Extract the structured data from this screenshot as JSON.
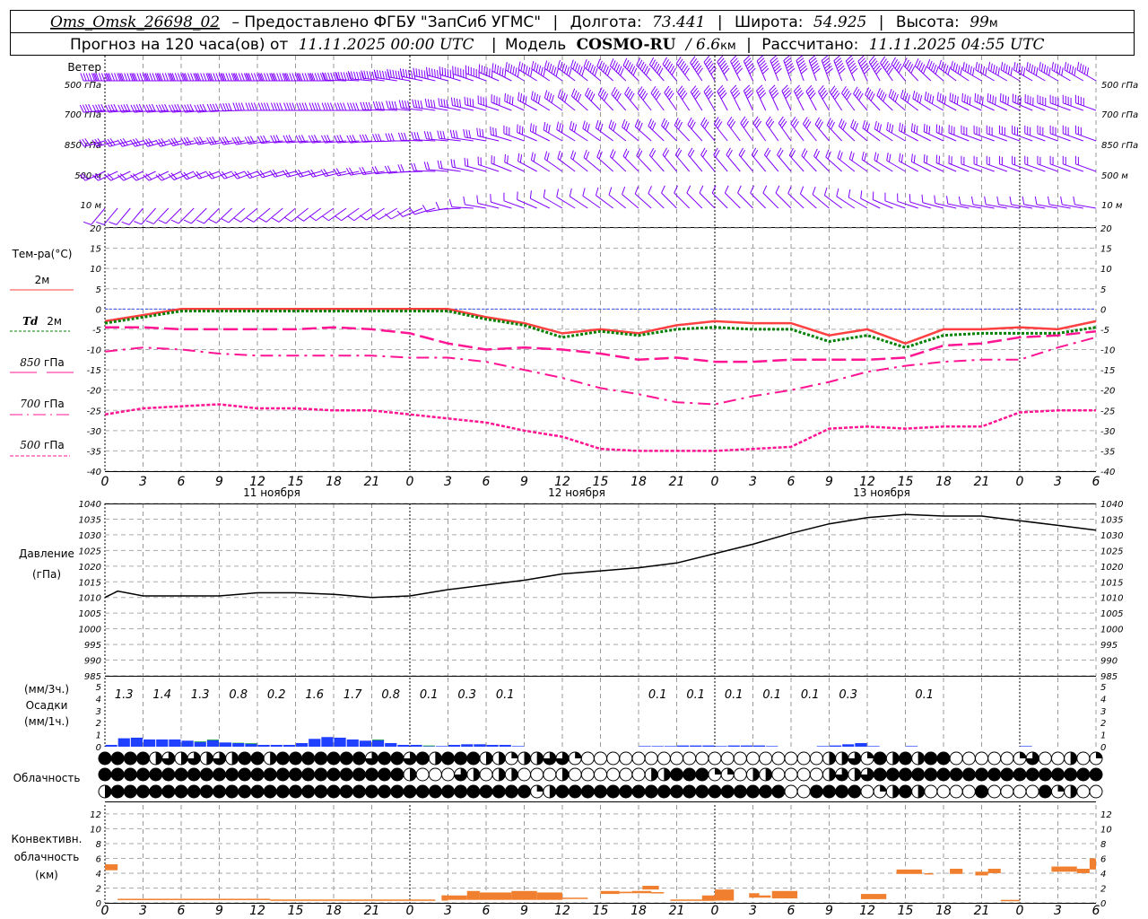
{
  "header": {
    "station": "Oms_Omsk_26698_02",
    "provider": "– Предоставлено ФГБУ \"ЗапСиб УГМС\"",
    "lon_label": "Долгота:",
    "lon": "73.441",
    "lat_label": "Широта:",
    "lat": "54.925",
    "alt_label": "Высота:",
    "alt": "99",
    "alt_unit": "м",
    "forecast_label": "Прогноз на 120 часа(ов) от",
    "forecast_time": "11.11.2025 00:00 UTC",
    "model_label": "Модель",
    "model": "COSMO-RU",
    "res": "/ 6.6",
    "res_unit": "км",
    "calc_label": "Рассчитано:",
    "calc_time": "11.11.2025 04:55 UTC"
  },
  "labels": {
    "wind": "Ветер",
    "wind_levels": [
      "500 гПа",
      "700 гПа",
      "850 гПа",
      "500 м",
      "10  м"
    ],
    "temp": "Тем-ра(°C)",
    "legend_2m": "2м",
    "legend_td": "Td",
    "legend_td2": "2м",
    "legend_850": "850",
    "legend_700": "700",
    "legend_500": "500",
    "legend_unit": "гПа",
    "pressure": "Давление",
    "pressure_unit": "(гПа)",
    "precip_3h": "(мм/3ч.)",
    "precip": "Осадки",
    "precip_1h": "(мм/1ч.)",
    "cloud": "Облачность",
    "conv1": "Конвективн.",
    "conv2": "облачность",
    "conv3": "(км)",
    "dates": [
      "11 ноября",
      "12 ноября",
      "13 ноября"
    ]
  },
  "colors": {
    "t2m": "#ff4040",
    "td": "#008000",
    "upper": "#ff1493",
    "zero": "#3050ff",
    "precip": "#2040ff",
    "snow": "#20c020",
    "conv": "#f08030",
    "wind": "#8000ff"
  },
  "chart_data": [
    {
      "type": "wind-barbs",
      "title": "Ветер",
      "hours_step": 3,
      "levels": [
        {
          "name": "500 гПа",
          "dir": [
            270,
            270,
            270,
            270,
            270,
            270,
            270,
            275,
            280,
            285,
            290,
            300,
            305,
            310,
            315,
            320,
            330,
            335,
            340,
            340,
            335,
            320,
            310,
            300,
            300,
            300,
            300
          ],
          "speed": [
            28,
            28,
            28,
            28,
            28,
            28,
            28,
            28,
            28,
            28,
            28,
            28,
            28,
            28,
            28,
            28,
            28,
            28,
            28,
            28,
            28,
            25,
            25,
            25,
            25,
            25,
            25
          ]
        },
        {
          "name": "700 гПа",
          "dir": [
            265,
            265,
            265,
            265,
            270,
            270,
            270,
            270,
            275,
            280,
            285,
            295,
            305,
            315,
            320,
            325,
            330,
            335,
            335,
            330,
            320,
            310,
            300,
            295,
            295,
            290,
            290
          ],
          "speed": [
            22,
            22,
            22,
            22,
            22,
            22,
            22,
            22,
            22,
            22,
            22,
            22,
            22,
            22,
            22,
            22,
            22,
            22,
            22,
            22,
            20,
            20,
            20,
            20,
            20,
            20,
            20
          ]
        },
        {
          "name": "850 гПа",
          "dir": [
            255,
            255,
            255,
            260,
            260,
            265,
            265,
            265,
            270,
            275,
            280,
            290,
            300,
            305,
            310,
            315,
            320,
            325,
            325,
            320,
            310,
            300,
            295,
            290,
            290,
            290,
            290
          ],
          "speed": [
            17,
            17,
            17,
            17,
            17,
            17,
            17,
            17,
            17,
            17,
            17,
            15,
            15,
            15,
            15,
            15,
            15,
            15,
            15,
            15,
            15,
            15,
            15,
            15,
            15,
            15,
            15
          ]
        },
        {
          "name": "500 м",
          "dir": [
            245,
            245,
            245,
            250,
            250,
            255,
            255,
            260,
            265,
            275,
            285,
            295,
            305,
            310,
            315,
            320,
            320,
            320,
            320,
            315,
            305,
            300,
            295,
            290,
            290,
            290,
            290
          ],
          "speed": [
            12,
            12,
            12,
            12,
            12,
            12,
            12,
            12,
            12,
            10,
            10,
            10,
            10,
            10,
            10,
            10,
            10,
            10,
            10,
            10,
            10,
            12,
            12,
            12,
            12,
            12,
            12
          ]
        },
        {
          "name": "10  м",
          "dir": [
            220,
            220,
            225,
            225,
            230,
            230,
            235,
            235,
            240,
            260,
            280,
            290,
            300,
            305,
            310,
            315,
            315,
            315,
            315,
            310,
            300,
            290,
            285,
            280,
            280,
            280,
            280
          ],
          "speed": [
            5,
            5,
            5,
            5,
            5,
            5,
            5,
            5,
            5,
            5,
            5,
            5,
            5,
            5,
            5,
            5,
            5,
            5,
            5,
            5,
            5,
            5,
            5,
            5,
            5,
            5,
            5
          ]
        }
      ]
    },
    {
      "type": "line",
      "title": "Тем-ра(°C)",
      "x_hours": [
        0,
        3,
        6,
        9,
        12,
        15,
        18,
        21,
        24,
        27,
        30,
        33,
        36,
        39,
        42,
        45,
        48,
        51,
        54,
        57,
        60,
        63,
        66,
        69,
        72,
        75,
        78
      ],
      "ylim": [
        -40,
        20
      ],
      "yticks": [
        20,
        15,
        10,
        5,
        0,
        -5,
        -10,
        -15,
        -20,
        -25,
        -30,
        -35,
        -40
      ],
      "grid": true,
      "series": [
        {
          "name": "2м",
          "style": "solid",
          "values": [
            -3,
            -1.5,
            0,
            0,
            0,
            0,
            0,
            0,
            0,
            0,
            -2,
            -3.5,
            -6,
            -5,
            -6,
            -4,
            -3,
            -3.5,
            -3.5,
            -6.5,
            -5,
            -8.5,
            -5,
            -5,
            -4.5,
            -5,
            -3
          ]
        },
        {
          "name": "Td 2м",
          "style": "dotted",
          "values": [
            -3.5,
            -2,
            -0.5,
            -0.5,
            -0.5,
            -0.5,
            -0.5,
            -0.5,
            -0.5,
            -0.5,
            -2.5,
            -4,
            -7,
            -5.5,
            -6.5,
            -5,
            -4.5,
            -5,
            -5,
            -8,
            -6.5,
            -9.5,
            -6.5,
            -6,
            -6,
            -6,
            -4.5
          ]
        },
        {
          "name": "850 гПа",
          "style": "longdash",
          "values": [
            -4.5,
            -4.5,
            -5,
            -5,
            -5,
            -5,
            -4.5,
            -5,
            -6,
            -8.5,
            -10,
            -9.5,
            -10,
            -11,
            -12.5,
            -12,
            -13,
            -13,
            -12.5,
            -12.5,
            -12.5,
            -12,
            -9,
            -8.5,
            -7,
            -6.5,
            -5.5
          ]
        },
        {
          "name": "700 гПа",
          "style": "dashdot",
          "values": [
            -10.5,
            -9.5,
            -10,
            -11,
            -11.5,
            -11.5,
            -11.5,
            -11.5,
            -12,
            -12,
            -13,
            -15,
            -17,
            -19.5,
            -21,
            -23,
            -23.5,
            -21.5,
            -20,
            -18,
            -15.5,
            -14,
            -13,
            -12.5,
            -12.5,
            -9.5,
            -7
          ]
        },
        {
          "name": "500 гПа",
          "style": "shortdash",
          "values": [
            -26,
            -24.5,
            -24,
            -23.5,
            -24.5,
            -24.5,
            -25,
            -25,
            -26,
            -27,
            -28,
            -30,
            -31.5,
            -34.5,
            -35,
            -35,
            -35,
            -34.5,
            -34,
            -29.5,
            -29,
            -29.5,
            -29,
            -29,
            -25.5,
            -25,
            -25
          ]
        }
      ]
    },
    {
      "type": "line",
      "title": "Давление (гПа)",
      "x_hours": [
        0,
        1,
        3,
        6,
        9,
        12,
        15,
        18,
        21,
        24,
        27,
        30,
        33,
        36,
        39,
        42,
        45,
        48,
        51,
        54,
        57,
        60,
        63,
        66,
        69,
        72,
        75,
        78
      ],
      "values": [
        1010,
        1012,
        1010.5,
        1010.5,
        1010.5,
        1011.5,
        1011.5,
        1011,
        1010,
        1010.5,
        1012.5,
        1014,
        1015.5,
        1017.5,
        1018.5,
        1019.5,
        1021,
        1024,
        1027,
        1030.5,
        1033.5,
        1035.5,
        1036.5,
        1036,
        1036,
        1034.5,
        1033,
        1031.5
      ],
      "ylim": [
        985,
        1040
      ],
      "yticks": [
        1040,
        1035,
        1030,
        1025,
        1020,
        1015,
        1010,
        1005,
        1000,
        995,
        990,
        985
      ],
      "grid": true
    },
    {
      "type": "bar",
      "title": "Осадки",
      "ylabel": "(мм/1ч.)",
      "ylim": [
        0,
        5
      ],
      "yticks": [
        5,
        4,
        3,
        2,
        1,
        0
      ],
      "hourly": [
        0.15,
        0.7,
        0.75,
        0.6,
        0.6,
        0.6,
        0.5,
        0.4,
        0.55,
        0.35,
        0.3,
        0.25,
        0.15,
        0.15,
        0.15,
        0.3,
        0.65,
        0.8,
        0.75,
        0.6,
        0.5,
        0.55,
        0.3,
        0.15,
        0.15,
        0.05,
        0.05,
        0.15,
        0.2,
        0.2,
        0.15,
        0.15,
        0.05,
        0,
        0,
        0,
        0,
        0,
        0,
        0,
        0,
        0,
        0.05,
        0.05,
        0.05,
        0.1,
        0.1,
        0.1,
        0.05,
        0.1,
        0.1,
        0.1,
        0.05,
        0,
        0,
        0,
        0.05,
        0.1,
        0.2,
        0.3,
        0.05,
        0,
        0,
        0.05,
        0,
        0,
        0,
        0,
        0,
        0,
        0,
        0,
        0.05,
        0,
        0,
        0,
        0,
        0
      ],
      "hourly_snow": {
        "7": 0.05,
        "8": 0.05,
        "10": 0.03,
        "11": 0.05,
        "21": 0.05,
        "25": 0.05
      },
      "totals_3h": [
        "1.3",
        "1.4",
        "1.3",
        "0.8",
        "0.2",
        "1.6",
        "1.7",
        "0.8",
        "0.1",
        "0.3",
        "0.1",
        "",
        "",
        "",
        "0.1",
        "0.1",
        "0.1",
        "0.1",
        "0.1",
        "0.3",
        "",
        "0.1",
        "",
        "",
        "",
        ""
      ]
    },
    {
      "type": "cloud-symbols",
      "title": "Облачность",
      "scale": "0=ясно, 4=сплошная (четверти)",
      "rows": [
        "4444232323244244444443443424442212233100000000000000000002231424244000001300201",
        "4444444444444444444444442000320220002000000224441102200002323444444444444444444",
        "2444444444444444444444444444444444124444444444444444440044440124200004000041200"
      ]
    },
    {
      "type": "range-bar",
      "title": "Конвективн. облачность (км)",
      "ylim": [
        0,
        13
      ],
      "yticks": [
        12,
        10,
        8,
        6,
        4,
        2,
        0
      ],
      "blocks": [
        {
          "from": 0,
          "to": 1,
          "base": 4.4,
          "top": 5.2
        },
        {
          "from": 1,
          "to": 13,
          "base": 0.4,
          "top": 0.55
        },
        {
          "from": 13,
          "to": 26,
          "base": 0.3,
          "top": 0.45
        },
        {
          "from": 26.5,
          "to": 27,
          "base": 0.3,
          "top": 1.0
        },
        {
          "from": 26.5,
          "to": 28.5,
          "base": 0.4,
          "top": 1.0
        },
        {
          "from": 28.5,
          "to": 29.5,
          "base": 0.4,
          "top": 1.6
        },
        {
          "from": 29.5,
          "to": 32,
          "base": 0.4,
          "top": 1.4
        },
        {
          "from": 32,
          "to": 34,
          "base": 0.4,
          "top": 1.6
        },
        {
          "from": 34,
          "to": 36,
          "base": 0.4,
          "top": 1.4
        },
        {
          "from": 36,
          "to": 38,
          "base": 0.6,
          "top": 0.7
        },
        {
          "from": 39,
          "to": 40.5,
          "base": 1.2,
          "top": 1.6
        },
        {
          "from": 40.5,
          "to": 41.5,
          "base": 1.3,
          "top": 1.5
        },
        {
          "from": 41.5,
          "to": 43,
          "base": 1.3,
          "top": 1.6
        },
        {
          "from": 43,
          "to": 44,
          "base": 1.3,
          "top": 1.45
        },
        {
          "from": 42.3,
          "to": 43.6,
          "base": 1.8,
          "top": 2.3
        },
        {
          "from": 44.5,
          "to": 48,
          "base": 0.3,
          "top": 0.45
        },
        {
          "from": 48,
          "to": 49.5,
          "base": 0.3,
          "top": 1.8
        },
        {
          "from": 47,
          "to": 48,
          "base": 0.4,
          "top": 1.0
        },
        {
          "from": 50.7,
          "to": 51.5,
          "base": 0.7,
          "top": 1.3
        },
        {
          "from": 51.5,
          "to": 52.4,
          "base": 0.7,
          "top": 1.0
        },
        {
          "from": 52.5,
          "to": 54.5,
          "base": 0.6,
          "top": 1.6
        },
        {
          "from": 59.5,
          "to": 61.5,
          "base": 0.5,
          "top": 1.2
        },
        {
          "from": 62.3,
          "to": 64.3,
          "base": 3.9,
          "top": 4.5
        },
        {
          "from": 64.5,
          "to": 65.2,
          "base": 3.9,
          "top": 4.0
        },
        {
          "from": 66.5,
          "to": 67.5,
          "base": 3.9,
          "top": 4.6
        },
        {
          "from": 68.5,
          "to": 69.5,
          "base": 3.7,
          "top": 4.2
        },
        {
          "from": 69.5,
          "to": 70.5,
          "base": 4.0,
          "top": 4.6
        },
        {
          "from": 70.5,
          "to": 72,
          "base": 0.3,
          "top": 0.4
        },
        {
          "from": 74.5,
          "to": 76.5,
          "base": 4.2,
          "top": 4.9
        },
        {
          "from": 76.5,
          "to": 77.5,
          "base": 4.0,
          "top": 4.6
        },
        {
          "from": 77.5,
          "to": 78,
          "base": 4.5,
          "top": 6.0
        }
      ]
    }
  ],
  "x_axis": {
    "labels": [
      "0",
      "3",
      "6",
      "9",
      "12",
      "15",
      "18",
      "21",
      "0",
      "3",
      "6",
      "9",
      "12",
      "15",
      "18",
      "21",
      "0",
      "3",
      "6",
      "9",
      "12",
      "15",
      "18",
      "21",
      "0",
      "3",
      "6"
    ]
  }
}
